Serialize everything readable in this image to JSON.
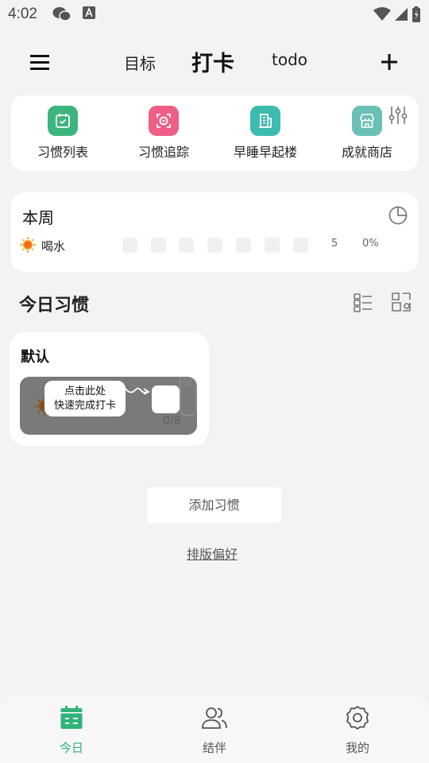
{
  "status_bar": {
    "time": "4:02"
  },
  "nav": {
    "tab_goals": "目标",
    "tab_checkin": "打卡",
    "tab_todo": "todo"
  },
  "shortcuts": [
    {
      "label": "习惯列表",
      "color": "#3bb57d",
      "icon": "calendar-check-icon"
    },
    {
      "label": "习惯追踪",
      "color": "#ef5f85",
      "icon": "target-scan-icon"
    },
    {
      "label": "早睡早起楼",
      "color": "#3bbcae",
      "icon": "building-icon"
    },
    {
      "label": "成就商店",
      "color": "#6bc0b6",
      "icon": "shop-icon"
    }
  ],
  "week": {
    "title": "本周",
    "habit": {
      "name": "喝水",
      "count": "5",
      "percent": "0%"
    }
  },
  "today": {
    "title": "今日习惯"
  },
  "group": {
    "title": "默认",
    "progress": "0/8",
    "ghost_count": "0/",
    "hint_line1": "点击此处",
    "hint_line2": "快速完成打卡"
  },
  "actions": {
    "add_habit": "添加习惯",
    "layout_pref": "排版偏好"
  },
  "bottom_nav": {
    "today": "今日",
    "partner": "结伴",
    "me": "我的"
  },
  "colors": {
    "accent": "#2fb37a"
  }
}
